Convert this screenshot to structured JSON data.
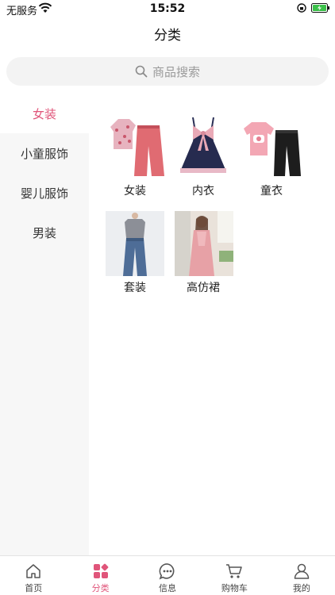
{
  "status_bar": {
    "carrier": "无服务",
    "time": "15:52"
  },
  "header": {
    "title": "分类"
  },
  "search": {
    "placeholder": "商品搜索"
  },
  "sidebar": {
    "items": [
      {
        "label": "女装",
        "active": true
      },
      {
        "label": "小童服饰",
        "active": false
      },
      {
        "label": "婴儿服饰",
        "active": false
      },
      {
        "label": "男装",
        "active": false
      }
    ]
  },
  "categories": [
    {
      "label": "女装",
      "icon": "floral-top-and-pants-image"
    },
    {
      "label": "内衣",
      "icon": "navy-dress-with-bow-image"
    },
    {
      "label": "童衣",
      "icon": "pink-shirt-black-pants-image"
    },
    {
      "label": "套装",
      "icon": "jeans-and-top-image"
    },
    {
      "label": "高仿裙",
      "icon": "woman-in-pink-dress-image"
    }
  ],
  "tab_bar": {
    "tabs": [
      {
        "label": "首页",
        "icon": "home-icon",
        "active": false
      },
      {
        "label": "分类",
        "icon": "category-icon",
        "active": true
      },
      {
        "label": "信息",
        "icon": "message-icon",
        "active": false
      },
      {
        "label": "购物车",
        "icon": "cart-icon",
        "active": false
      },
      {
        "label": "我的",
        "icon": "profile-icon",
        "active": false
      }
    ]
  },
  "colors": {
    "accent": "#e0557a",
    "sidebar_bg": "#f7f7f7",
    "search_bg": "#f3f3f3"
  }
}
